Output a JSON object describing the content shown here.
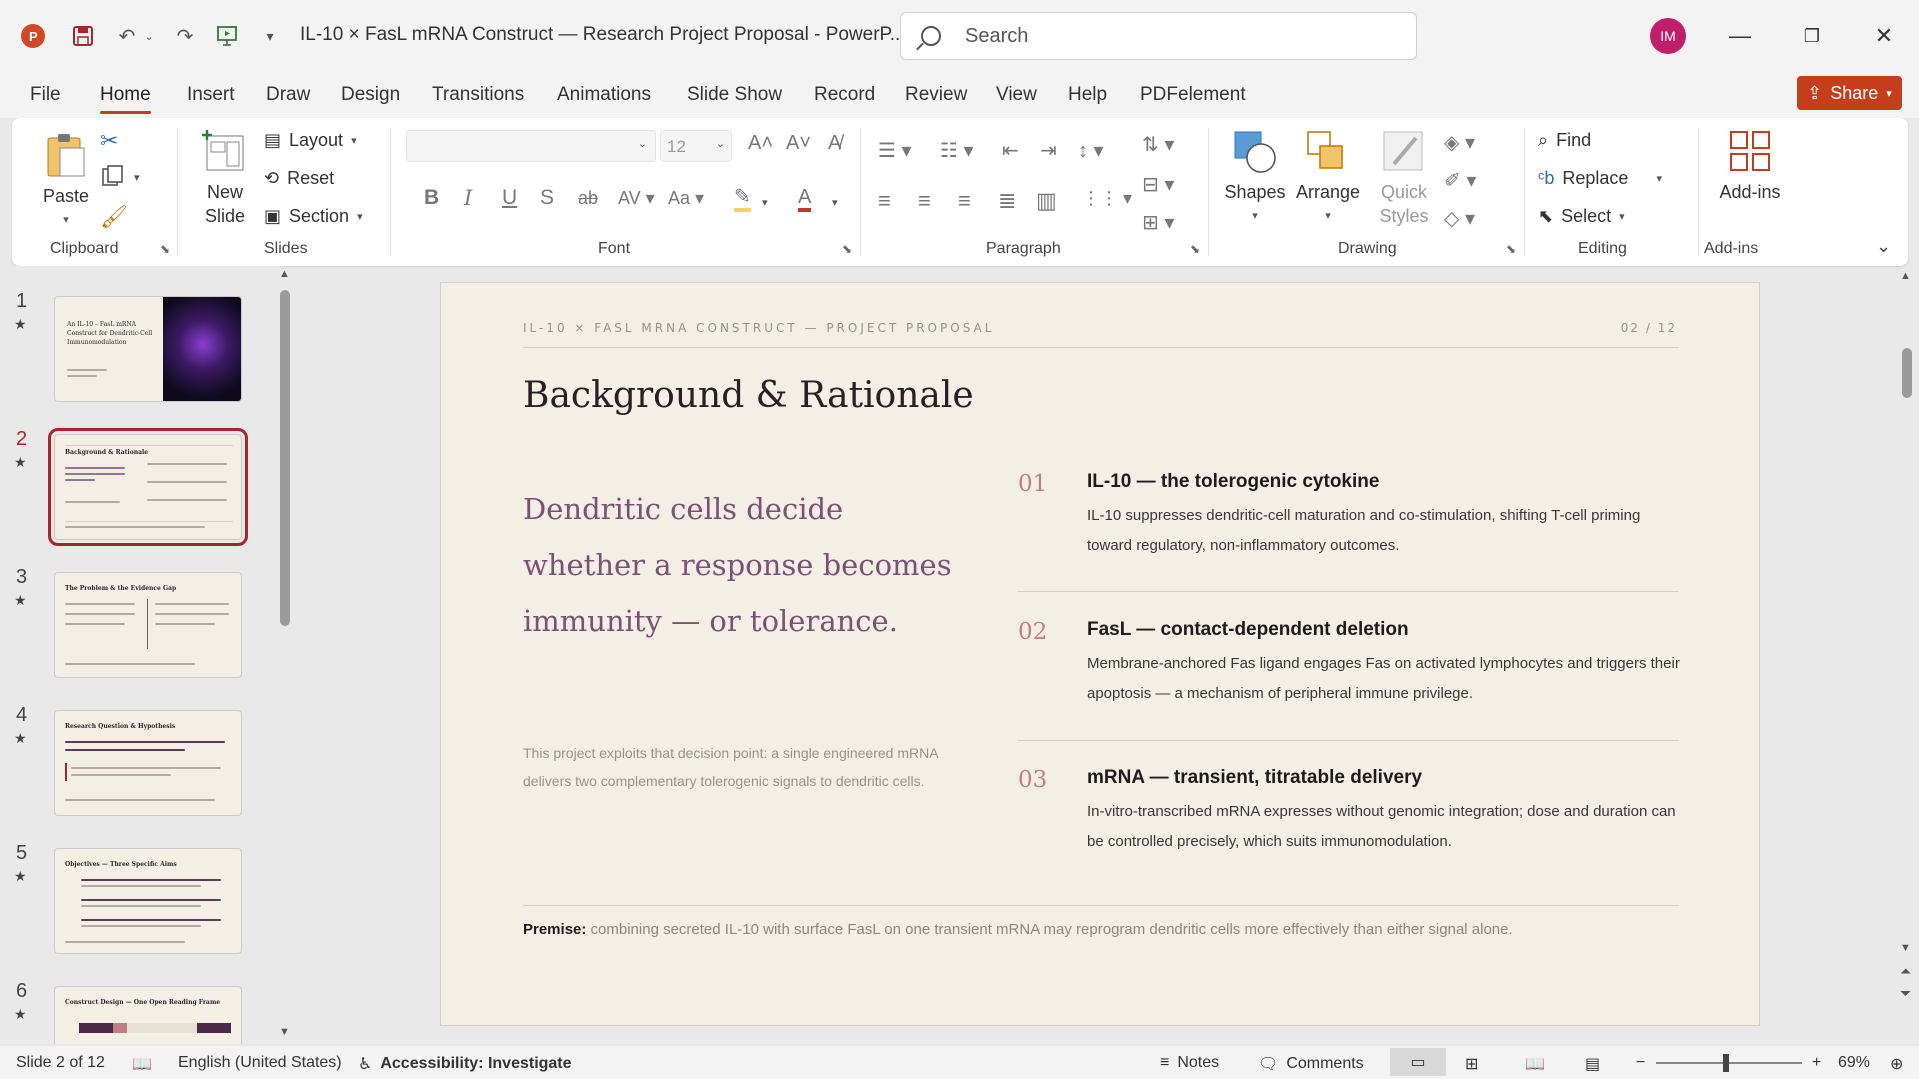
{
  "titlebar": {
    "doc_title": "IL-10 × FasL mRNA Construct — Research Project Proposal  -  PowerP...",
    "search_placeholder": "Search",
    "avatar_initials": "IM"
  },
  "menu": {
    "tabs": [
      "File",
      "Home",
      "Insert",
      "Draw",
      "Design",
      "Transitions",
      "Animations",
      "Slide Show",
      "Record",
      "Review",
      "View",
      "Help",
      "PDFelement"
    ],
    "active": "Home",
    "share_label": "Share"
  },
  "ribbon": {
    "clipboard": {
      "paste": "Paste",
      "label": "Clipboard"
    },
    "slides": {
      "new_slide_1": "New",
      "new_slide_2": "Slide",
      "layout": "Layout",
      "reset": "Reset",
      "section": "Section",
      "label": "Slides"
    },
    "font": {
      "size": "12",
      "label": "Font"
    },
    "paragraph": {
      "label": "Paragraph"
    },
    "drawing": {
      "shapes": "Shapes",
      "arrange": "Arrange",
      "quick_styles_1": "Quick",
      "quick_styles_2": "Styles",
      "label": "Drawing"
    },
    "editing": {
      "find": "Find",
      "replace": "Replace",
      "select": "Select",
      "label": "Editing"
    },
    "addins": {
      "button": "Add-ins",
      "label": "Add-ins"
    }
  },
  "thumbnails": [
    {
      "num": "1",
      "title_lines": [
        "An IL-10 – FasL mRNA",
        "Construct for Dendritic-Cell",
        "Immunomodulation"
      ]
    },
    {
      "num": "2",
      "title_lines": [
        "Background & Rationale"
      ]
    },
    {
      "num": "3",
      "title_lines": [
        "The Problem & the Evidence Gap"
      ]
    },
    {
      "num": "4",
      "title_lines": [
        "Research Question & Hypothesis"
      ]
    },
    {
      "num": "5",
      "title_lines": [
        "Objectives — Three Specific Aims"
      ]
    },
    {
      "num": "6",
      "title_lines": [
        "Construct Design — One Open Reading Frame"
      ]
    }
  ],
  "slide": {
    "header_left": "IL-10 × FASL MRNA CONSTRUCT — PROJECT PROPOSAL",
    "header_right": "02 / 12",
    "title": "Background & Rationale",
    "quote": "Dendritic cells decide whether a response becomes immunity — or tolerance.",
    "note": "This project exploits that decision point: a single engineered mRNA delivers two complementary tolerogenic signals to dendritic cells.",
    "points": [
      {
        "num": "01",
        "head": "IL-10 — the tolerogenic cytokine",
        "body": "IL-10 suppresses dendritic-cell maturation and co-stimulation, shifting T-cell priming toward regulatory, non-inflammatory outcomes."
      },
      {
        "num": "02",
        "head": "FasL — contact-dependent deletion",
        "body": "Membrane-anchored Fas ligand engages Fas on activated lymphocytes and triggers their apoptosis — a mechanism of peripheral immune privilege."
      },
      {
        "num": "03",
        "head": "mRNA — transient, titratable delivery",
        "body": "In-vitro-transcribed mRNA expresses without genomic integration; dose and duration can be controlled precisely, which suits immunomodulation."
      }
    ],
    "premise_label": "Premise:",
    "premise_text": " combining secreted IL-10 with surface FasL on one transient mRNA may reprogram dendritic cells more effectively than either signal alone."
  },
  "status": {
    "slide_of": "Slide 2 of 12",
    "language": "English (United States)",
    "accessibility": "Accessibility: Investigate",
    "notes": "Notes",
    "comments": "Comments",
    "zoom": "69%"
  },
  "colors": {
    "accent": "#c43e1c",
    "slide_bg": "#f4efe4",
    "quote": "#7c4f76",
    "number": "#c07f86",
    "selected_thumb": "#a4262c"
  }
}
